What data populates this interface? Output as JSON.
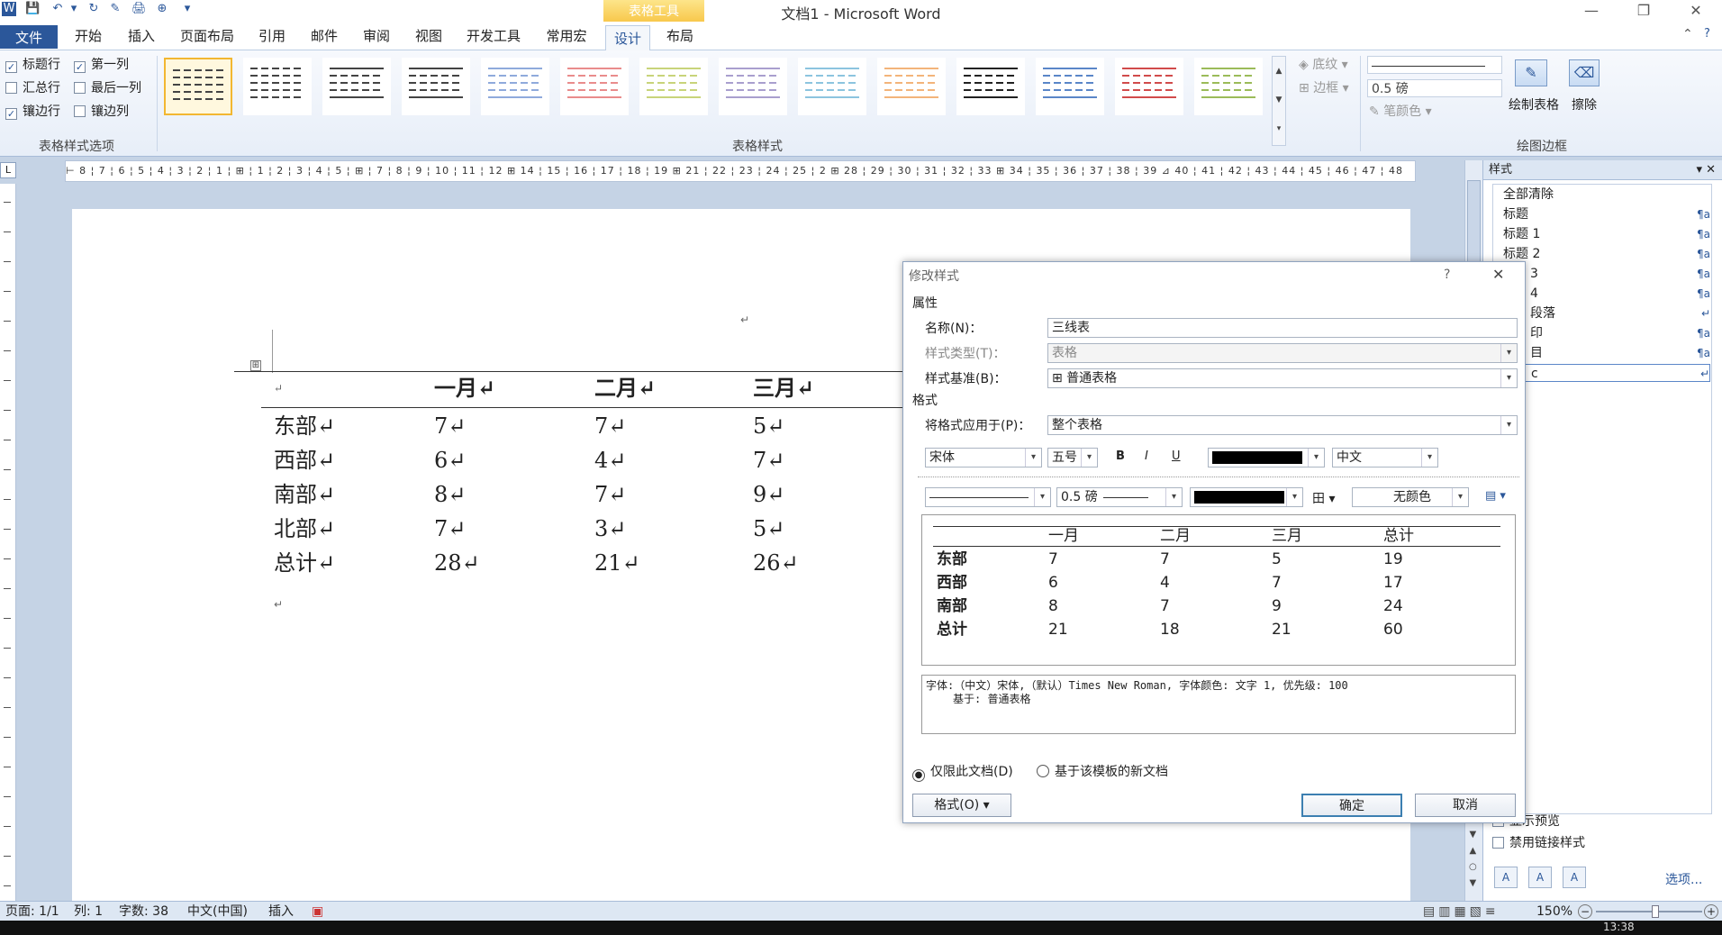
{
  "window": {
    "title": "文档1 - Microsoft Word",
    "minimize": "—",
    "restore": "❐",
    "close": "✕",
    "context_tool": "表格工具"
  },
  "qat": [
    "W",
    "💾",
    "↶",
    "▾",
    "↻",
    "✎",
    "🖨",
    "⊕",
    "▾"
  ],
  "tabs": [
    "文件",
    "开始",
    "插入",
    "页面布局",
    "引用",
    "邮件",
    "审阅",
    "视图",
    "开发工具",
    "常用宏",
    "设计",
    "布局"
  ],
  "ribbon_extra": {
    "collapse": "⌃",
    "help": "?"
  },
  "ribbon": {
    "style_options": {
      "label": "表格样式选项",
      "items": [
        {
          "text": "标题行",
          "checked": true
        },
        {
          "text": "第一列",
          "checked": true
        },
        {
          "text": "汇总行",
          "checked": false
        },
        {
          "text": "最后一列",
          "checked": false
        },
        {
          "text": "镶边行",
          "checked": true
        },
        {
          "text": "镶边列",
          "checked": false
        }
      ]
    },
    "table_styles": {
      "label": "表格样式",
      "colors": [
        "#444444",
        "#444444",
        "#444444",
        "#444444",
        "#8faadc",
        "#e98c8c",
        "#c8d47a",
        "#a99fce",
        "#8cc4df",
        "#f3b47a",
        "#222222",
        "#5a86c8",
        "#d14b4b",
        "#9bbb59"
      ]
    },
    "shading": "底纹",
    "borders": "边框",
    "pen_weight": "0.5 磅",
    "pen_color": "笔颜色",
    "draw_table": "绘制表格",
    "eraser": "擦除",
    "draw_label": "绘图边框"
  },
  "ruler": {
    "text": "⊢ 8 ¦ 7 ¦ 6 ¦ 5 ¦ 4 ¦ 3 ¦ 2 ¦ 1 ¦ ⊞ ¦ 1 ¦ 2 ¦ 3 ¦ 4 ¦ 5 ¦ ⊞ ¦ 7 ¦ 8 ¦ 9 ¦ 10 ¦ 11 ¦ 12 ⊞ 14 ¦ 15 ¦ 16 ¦ 17 ¦ 18 ¦ 19 ⊞ 21 ¦ 22 ¦ 23 ¦ 24 ¦ 25 ¦ 2 ⊞ 28 ¦ 29 ¦ 30 ¦ 31 ¦ 32 ¦ 33 ⊞ 34 ¦ 35 ¦ 36 ¦ 37 ¦ 38 ¦ 39 ⊿ 40 ¦ 41 ¦ 42 ¦ 43 ¦ 44 ¦ 45 ¦ 46 ¦ 47 ¦ 48",
    "corner": "L"
  },
  "document": {
    "header": [
      "↵",
      "一月↵",
      "二月↵",
      "三月↵"
    ],
    "rows": [
      [
        "东部↵",
        "7↵",
        "7↵",
        "5↵"
      ],
      [
        "西部↵",
        "6↵",
        "4↵",
        "7↵"
      ],
      [
        "南部↵",
        "8↵",
        "7↵",
        "9↵"
      ],
      [
        "北部↵",
        "7↵",
        "3↵",
        "5↵"
      ],
      [
        "总计↵",
        "28↵",
        "21↵",
        "26↵"
      ]
    ],
    "para_mark": "↵",
    "move_handle": "⊞"
  },
  "styles_pane": {
    "title": "样式",
    "items": [
      "全部清除",
      "标题",
      "标题 1",
      "标题 2",
      "3",
      "4",
      "段落",
      "印",
      "目",
      "c"
    ],
    "show_preview": "显示预览",
    "disable_linked": "禁用链接样式",
    "options": "选项..."
  },
  "status": {
    "page": "页面: 1/1",
    "column": "列: 1",
    "words": "字数: 38",
    "lang": "中文(中国)",
    "mode": "插入",
    "zoom": "150%",
    "time": "13:38"
  },
  "dialog": {
    "title": "修改样式",
    "help": "?",
    "close": "✕",
    "section_props": "属性",
    "section_format": "格式",
    "name_label": "名称(N)：",
    "name_value": "三线表",
    "type_label": "样式类型(T)：",
    "type_value": "表格",
    "base_label": "样式基准(B)：",
    "base_value": "⊞ 普通表格",
    "apply_label": "将格式应用于(P)：",
    "apply_value": "整个表格",
    "font": "宋体",
    "size": "五号",
    "bold": "B",
    "italic": "I",
    "underline": "U",
    "script": "中文",
    "line_weight": "0.5 磅",
    "no_color": "无颜色",
    "grid_icon": "田",
    "preview": {
      "header": [
        "",
        "一月",
        "二月",
        "三月",
        "总计"
      ],
      "rows": [
        [
          "东部",
          "7",
          "7",
          "5",
          "19"
        ],
        [
          "西部",
          "6",
          "4",
          "7",
          "17"
        ],
        [
          "南部",
          "8",
          "7",
          "9",
          "24"
        ],
        [
          "总计",
          "21",
          "18",
          "21",
          "60"
        ]
      ]
    },
    "description_line1": "字体:（中文）宋体,（默认）Times New Roman, 字体颜色: 文字 1, 优先级: 100",
    "description_line2": "基于: 普通表格",
    "radio_doc": "仅限此文档(D)",
    "radio_template": "基于该模板的新文档",
    "format_btn": "格式(O) ▾",
    "ok": "确定",
    "cancel": "取消"
  }
}
